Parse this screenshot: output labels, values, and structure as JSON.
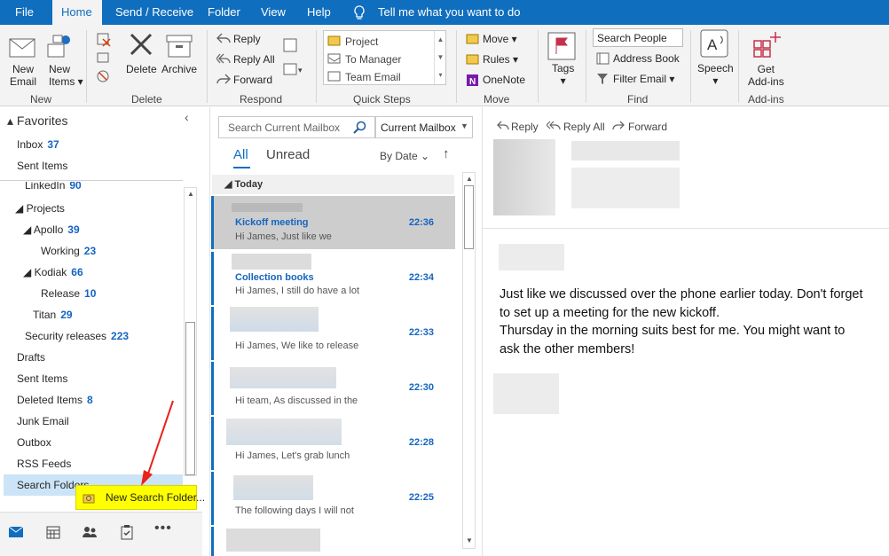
{
  "tabs": {
    "file": "File",
    "home": "Home",
    "send_receive": "Send / Receive",
    "folder": "Folder",
    "view": "View",
    "help": "Help",
    "tell_me": "Tell me what you want to do"
  },
  "ribbon": {
    "new_email": [
      "New",
      "Email"
    ],
    "new_items": [
      "New",
      "Items"
    ],
    "delete": "Delete",
    "archive": "Archive",
    "reply": "Reply",
    "reply_all": "Reply All",
    "forward": "Forward",
    "quick_steps": [
      "Project",
      "To Manager",
      "Team Email"
    ],
    "move": "Move",
    "rules": "Rules",
    "onenote": "OneNote",
    "tags": "Tags",
    "search_people_placeholder": "Search People",
    "address_book": "Address Book",
    "filter_email": "Filter Email",
    "speech": "Speech",
    "get_addins": [
      "Get",
      "Add-ins"
    ],
    "groups": {
      "new": "New",
      "delete": "Delete",
      "respond": "Respond",
      "quick_steps": "Quick Steps",
      "move": "Move",
      "find": "Find",
      "addins": "Add-ins"
    }
  },
  "nav": {
    "favorites": "Favorites",
    "inbox": {
      "label": "Inbox",
      "count": "37"
    },
    "sent_items_fav": "Sent Items",
    "linkedin": {
      "label": "LinkedIn",
      "count": "90"
    },
    "projects": "Projects",
    "apollo": {
      "label": "Apollo",
      "count": "39"
    },
    "working": {
      "label": "Working",
      "count": "23"
    },
    "kodiak": {
      "label": "Kodiak",
      "count": "66"
    },
    "release": {
      "label": "Release",
      "count": "10"
    },
    "titan": {
      "label": "Titan",
      "count": "29"
    },
    "security": {
      "label": "Security releases",
      "count": "223"
    },
    "drafts": "Drafts",
    "sent_items": "Sent Items",
    "deleted": {
      "label": "Deleted Items",
      "count": "8"
    },
    "junk": "Junk Email",
    "outbox": "Outbox",
    "rss": "RSS Feeds",
    "search_folders": "Search Folders",
    "context_new_search_folder": "New Search Folder..."
  },
  "list": {
    "search_placeholder": "Search Current Mailbox",
    "scope": "Current Mailbox",
    "filter_all": "All",
    "filter_unread": "Unread",
    "sort": "By Date",
    "group_today": "Today",
    "messages": [
      {
        "subject": "Kickoff meeting",
        "preview": "Hi James,  Just like we",
        "time": "22:36"
      },
      {
        "subject": "Collection books",
        "preview": "Hi James,  I still do have a lot",
        "time": "22:34"
      },
      {
        "subject": "",
        "preview": "Hi James,  We like to release",
        "time": "22:33"
      },
      {
        "subject": "",
        "preview": "Hi team,  As discussed in the",
        "time": "22:30"
      },
      {
        "subject": "",
        "preview": "Hi James,  Let's grab lunch",
        "time": "22:28"
      },
      {
        "subject": "",
        "preview": "The following days I will not",
        "time": "22:25"
      }
    ]
  },
  "reading": {
    "reply": "Reply",
    "reply_all": "Reply All",
    "forward": "Forward",
    "body": [
      "Just like we discussed over the phone earlier today. Don't forget",
      "to set up a meeting for the new kickoff.",
      "Thursday in the morning suits best for me. You might want to",
      "ask the other members!"
    ]
  },
  "colors": {
    "accent": "#106ebe",
    "unread_count": "#1565c0",
    "highlight": "#ffff00",
    "arrow": "#e8231a"
  }
}
